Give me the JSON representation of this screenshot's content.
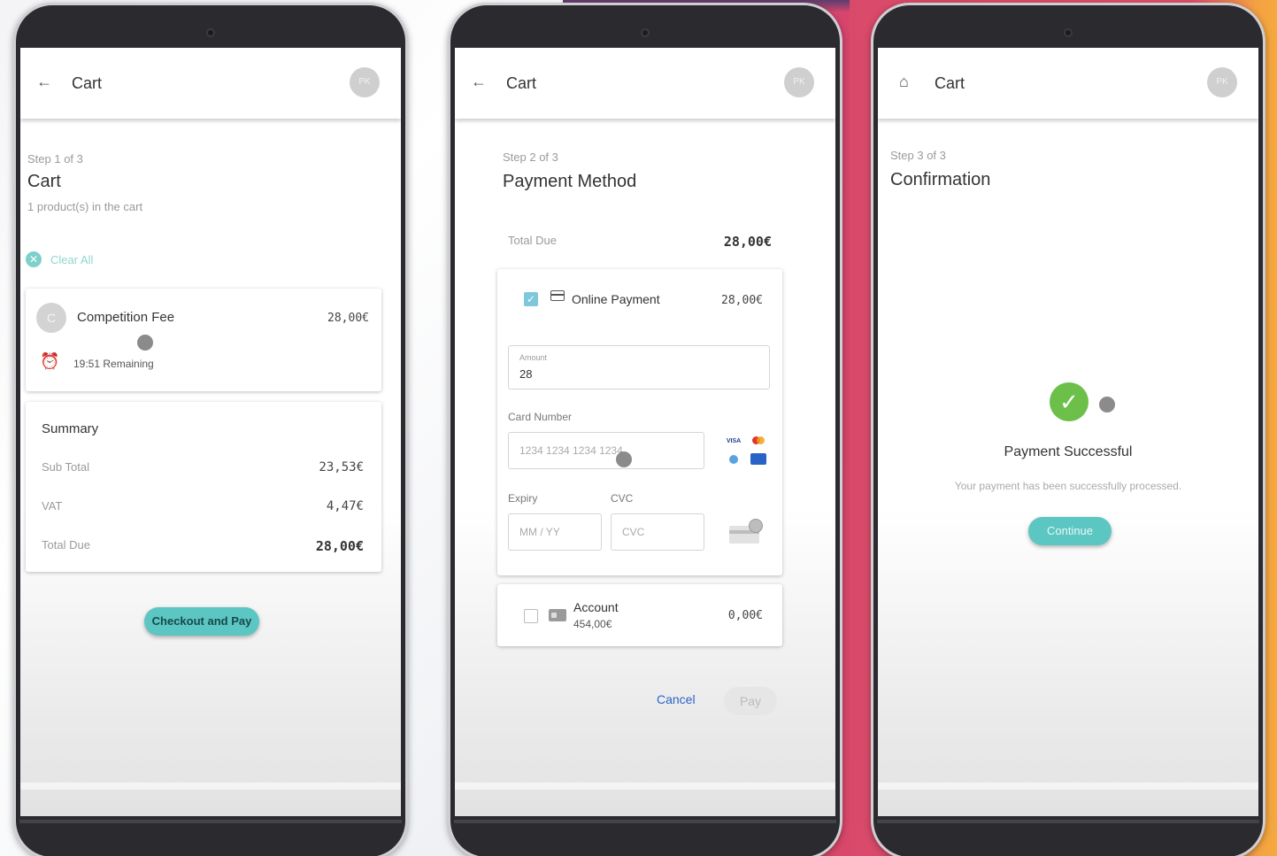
{
  "screen1": {
    "appbar": {
      "title": "Cart",
      "avatar": "PK"
    },
    "step": "Step 1 of 3",
    "heading": "Cart",
    "subtitle": "1 product(s) in the cart",
    "clear_all": "Clear All",
    "item": {
      "avatar": "C",
      "name": "Competition Fee",
      "price": "28,00€",
      "timer": "19:51 Remaining"
    },
    "summary": {
      "title": "Summary",
      "rows": [
        {
          "label": "Sub Total",
          "value": "23,53€"
        },
        {
          "label": "VAT",
          "value": "4,47€"
        },
        {
          "label": "Total Due",
          "value": "28,00€"
        }
      ]
    },
    "checkout_button": "Checkout and Pay"
  },
  "screen2": {
    "appbar": {
      "title": "Cart",
      "avatar": "PK"
    },
    "step": "Step 2 of 3",
    "heading": "Payment Method",
    "total_due": {
      "label": "Total Due",
      "value": "28,00€"
    },
    "online": {
      "label": "Online Payment",
      "value": "28,00€",
      "amount_label": "Amount",
      "amount_value": "28",
      "card_label": "Card Number",
      "card_placeholder": "1234 1234 1234 1234",
      "expiry_label": "Expiry",
      "expiry_placeholder": "MM / YY",
      "cvc_label": "CVC",
      "cvc_placeholder": "CVC"
    },
    "account": {
      "label": "Account",
      "balance": "454,00€",
      "value": "0,00€"
    },
    "cancel": "Cancel",
    "pay": "Pay"
  },
  "screen3": {
    "appbar": {
      "title": "Cart",
      "avatar": "PK"
    },
    "step": "Step 3 of 3",
    "heading": "Confirmation",
    "success_title": "Payment Successful",
    "success_text": "Your payment has been successfully processed.",
    "continue": "Continue"
  },
  "colors": {
    "teal": "#5cc6c2",
    "success": "#6cc04a",
    "accent_blue": "#2a63c8",
    "bg_pink": "#d9476a",
    "bg_orange": "#f5a93e"
  },
  "icons": [
    "back-arrow-icon",
    "home-icon",
    "clear-icon",
    "alarm-clock-icon",
    "checkbox-checked-icon",
    "credit-card-icon",
    "wallet-icon",
    "checkmark-icon",
    "visa-icon",
    "mastercard-icon",
    "diners-icon",
    "amex-icon",
    "card-cvc-icon"
  ]
}
